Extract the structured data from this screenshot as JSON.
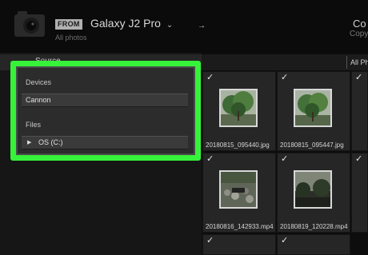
{
  "header": {
    "from_badge": "FROM",
    "source_name": "Galaxy J2 Pro",
    "source_chevron": "⌄",
    "source_sub": "All photos",
    "arrow": "→",
    "right_title": "Co",
    "right_sub": "Copy"
  },
  "left_panel": {
    "header_label": "Source",
    "devices_label": "Devices",
    "device_item": "Cannon",
    "files_label": "Files",
    "files_item": "OS (C:)",
    "highlight_color": "#36f23a"
  },
  "grid": {
    "filter_label": "All Ph",
    "checkmark": "✓",
    "thumbnails": [
      {
        "filename": "20180815_095440.jpg",
        "kind": "tree-photo"
      },
      {
        "filename": "20180815_095447.jpg",
        "kind": "tree-photo"
      },
      {
        "filename": "20180816_142933.mp4",
        "kind": "rocks-video"
      },
      {
        "filename": "20180819_120228.mp4",
        "kind": "dark-trees-video"
      }
    ]
  }
}
